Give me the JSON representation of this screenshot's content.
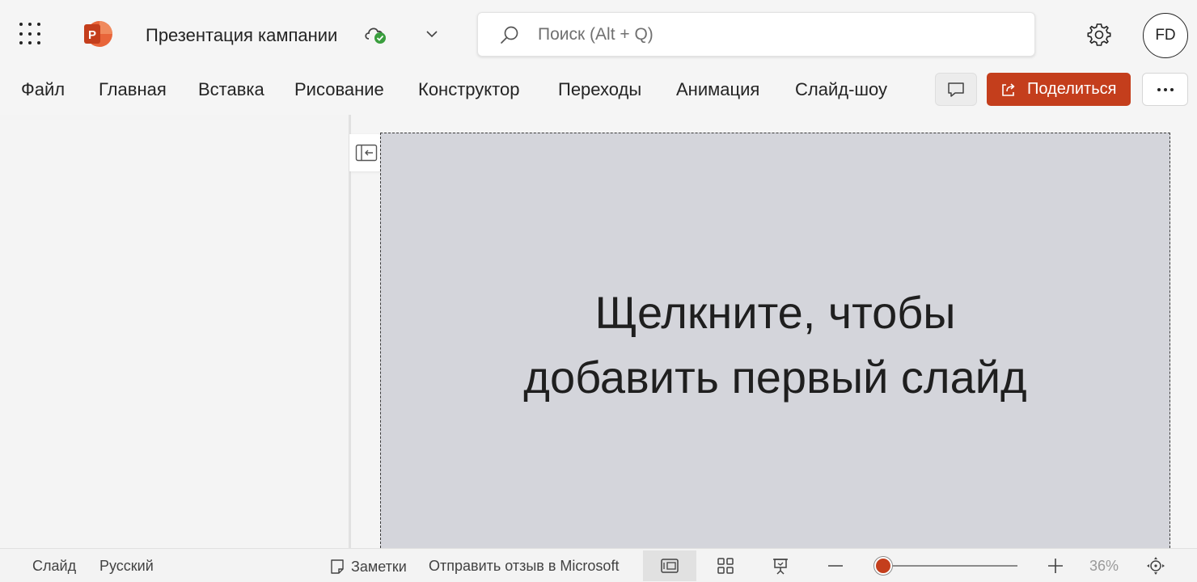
{
  "app": {
    "document_title": "Презентация кампании",
    "app_letter": "P",
    "brand_color": "#c43e1c",
    "icons": {
      "launcher": "waffle-icon",
      "app": "powerpoint-icon",
      "sync": "cloud-check-icon",
      "title_menu": "chevron-down-icon"
    }
  },
  "search": {
    "placeholder": "Поиск (Alt + Q)",
    "value": "",
    "icon": "search-icon"
  },
  "header": {
    "settings_icon": "gear-icon",
    "avatar_initials": "FD"
  },
  "ribbon": {
    "tabs": [
      {
        "label": "Файл"
      },
      {
        "label": "Главная"
      },
      {
        "label": "Вставка"
      },
      {
        "label": "Рисование"
      },
      {
        "label": "Конструктор"
      },
      {
        "label": "Переходы"
      },
      {
        "label": "Анимация"
      },
      {
        "label": "Слайд-шоу"
      }
    ],
    "comments_icon": "comment-icon",
    "share": {
      "label": "Поделиться",
      "icon": "share-icon"
    },
    "more_icon": "more-icon"
  },
  "editor": {
    "collapse_icon": "collapse-pane-icon",
    "placeholder_line1": "Щелкните, чтобы",
    "placeholder_line2": "добавить первый слайд",
    "placeholder_bg": "#d4d5db"
  },
  "statusbar": {
    "slide_label": "Слайд",
    "language": "Русский",
    "notes_label": "Заметки",
    "feedback_label": "Отправить отзыв в Microsoft",
    "views": [
      "normal-view-icon",
      "slide-sorter-icon",
      "reading-view-icon"
    ],
    "active_view": "normal-view-icon",
    "zoom_percent": "36%",
    "zoom_value": 36
  }
}
